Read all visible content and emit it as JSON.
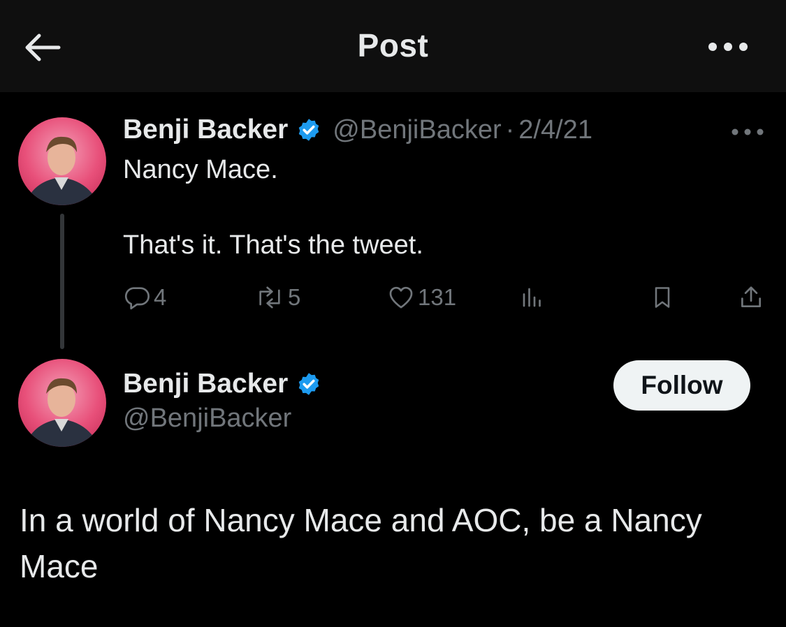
{
  "header": {
    "title": "Post",
    "back_icon": "arrow-left-icon",
    "more_icon": "more-horizontal-icon"
  },
  "parent_tweet": {
    "author_name": "Benji Backer",
    "handle": "@BenjiBacker",
    "separator": "·",
    "date": "2/4/21",
    "verified": true,
    "text_line1": "Nancy Mace.",
    "text_line2": "That's it. That's the tweet.",
    "actions": {
      "replies": "4",
      "retweets": "5",
      "likes": "131"
    }
  },
  "main_tweet": {
    "author_name": "Benji Backer",
    "handle": "@BenjiBacker",
    "verified": true,
    "follow_label": "Follow",
    "text": "In a world of Nancy Mace and AOC, be a Nancy Mace"
  },
  "colors": {
    "background": "#000000",
    "header_bg": "#0f0f0f",
    "text_primary": "#e7e9ea",
    "text_secondary": "#71767b",
    "verified_blue": "#1d9bf0",
    "follow_bg": "#eff3f4"
  }
}
